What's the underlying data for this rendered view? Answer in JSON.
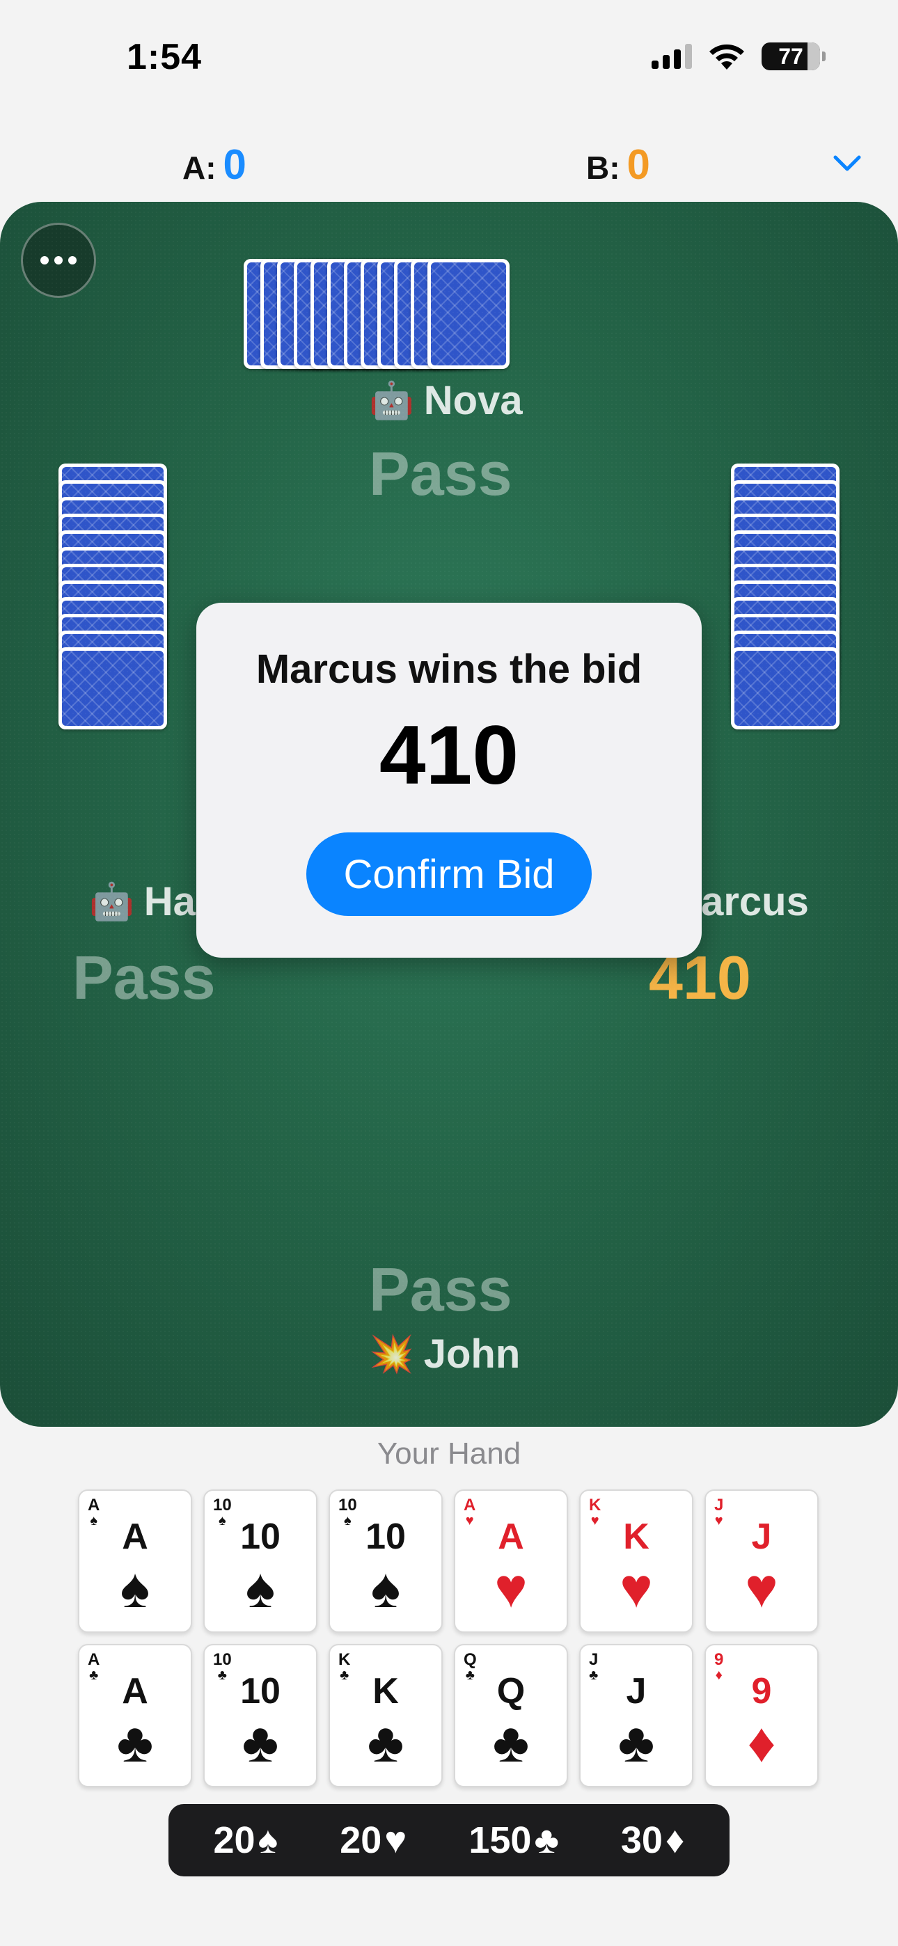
{
  "status": {
    "time": "1:54",
    "battery": "77"
  },
  "scores": {
    "a_label": "A:",
    "a_value": "0",
    "b_label": "B:",
    "b_value": "0"
  },
  "players": {
    "north": {
      "emoji": "🤖",
      "name": "Nova",
      "bid": "Pass"
    },
    "west": {
      "emoji": "🤖",
      "name": "Hal",
      "bid": "Pass"
    },
    "east": {
      "emoji": "👾",
      "name": "Marcus",
      "bid": "410"
    },
    "south": {
      "emoji": "💥",
      "name": "John",
      "bid": "Pass"
    }
  },
  "dialog": {
    "title": "Marcus wins the bid",
    "amount": "410",
    "confirm_label": "Confirm Bid"
  },
  "hand": {
    "label": "Your Hand",
    "cards": [
      {
        "rank": "A",
        "suit": "♠",
        "color": "black"
      },
      {
        "rank": "10",
        "suit": "♠",
        "color": "black"
      },
      {
        "rank": "10",
        "suit": "♠",
        "color": "black"
      },
      {
        "rank": "A",
        "suit": "♥",
        "color": "red"
      },
      {
        "rank": "K",
        "suit": "♥",
        "color": "red"
      },
      {
        "rank": "J",
        "suit": "♥",
        "color": "red"
      },
      {
        "rank": "A",
        "suit": "♣",
        "color": "black"
      },
      {
        "rank": "10",
        "suit": "♣",
        "color": "black"
      },
      {
        "rank": "K",
        "suit": "♣",
        "color": "black"
      },
      {
        "rank": "Q",
        "suit": "♣",
        "color": "black"
      },
      {
        "rank": "J",
        "suit": "♣",
        "color": "black"
      },
      {
        "rank": "9",
        "suit": "♦",
        "color": "red"
      }
    ]
  },
  "meld": [
    {
      "value": "20",
      "suit": "♠"
    },
    {
      "value": "20",
      "suit": "♥"
    },
    {
      "value": "150",
      "suit": "♣"
    },
    {
      "value": "30",
      "suit": "♦"
    }
  ],
  "colors": {
    "accent": "#0a84ff",
    "team_a": "#1a8cff",
    "team_b": "#f39a24",
    "felt": "#246548",
    "winning_bid": "#f5b547"
  }
}
